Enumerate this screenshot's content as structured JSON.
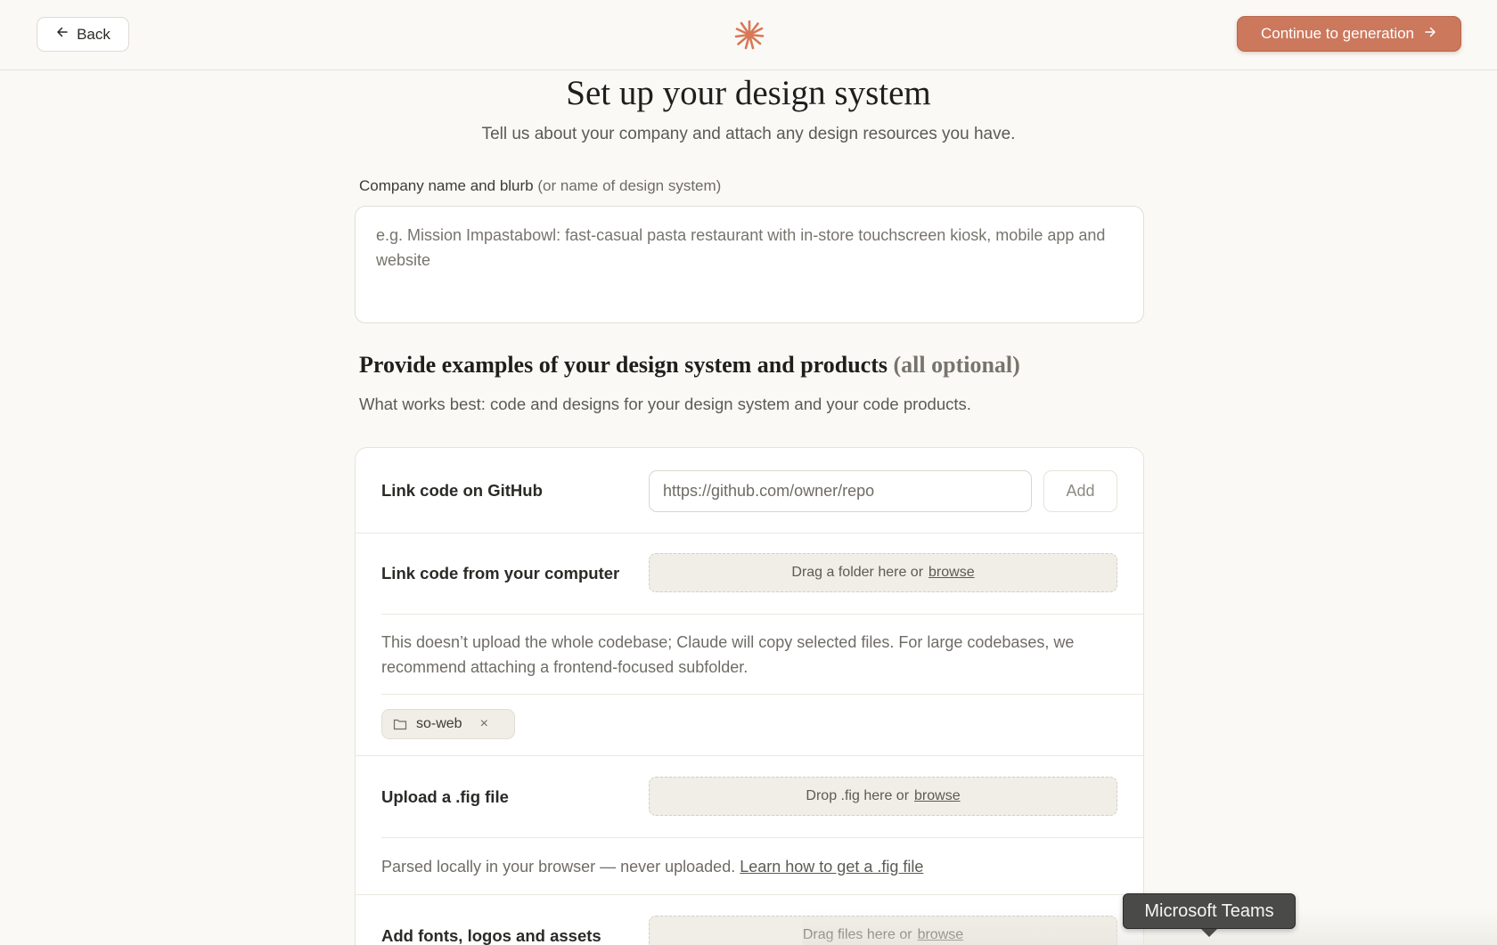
{
  "header": {
    "back_label": "Back",
    "continue_label": "Continue to generation",
    "accent_color": "#cc785c"
  },
  "page": {
    "title": "Set up your design system",
    "subtitle": "Tell us about your company and attach any design resources you have."
  },
  "company_field": {
    "label": "Company name and blurb",
    "label_hint": "(or name of design system)",
    "value": "",
    "placeholder": "e.g. Mission Impastabowl: fast-casual pasta restaurant with in-store touchscreen kiosk, mobile app and website"
  },
  "examples_section": {
    "title": "Provide examples of your design system and products",
    "title_hint": "(all optional)",
    "description": "What works best: code and designs for your design system and your code products."
  },
  "github": {
    "label": "Link code on GitHub",
    "placeholder": "https://github.com/owner/repo",
    "value": "",
    "add_label": "Add"
  },
  "computer": {
    "label": "Link code from your computer",
    "dropzone_text": "Drag a folder here or",
    "browse_label": "browse",
    "note": "This doesn’t upload the whole codebase; Claude will copy selected files. For large codebases, we recommend attaching a frontend-focused subfolder.",
    "attached": [
      {
        "name": "so-web",
        "icon": "folder-icon"
      }
    ]
  },
  "fig": {
    "label": "Upload a .fig file",
    "dropzone_text": "Drop .fig here or",
    "browse_label": "browse",
    "note": "Parsed locally in your browser — never uploaded.",
    "note_link": "Learn how to get a .fig file"
  },
  "assets": {
    "label": "Add fonts, logos and assets",
    "dropzone_text": "Drag files here or",
    "browse_label": "browse"
  },
  "tooltip": {
    "text": "Microsoft Teams"
  }
}
